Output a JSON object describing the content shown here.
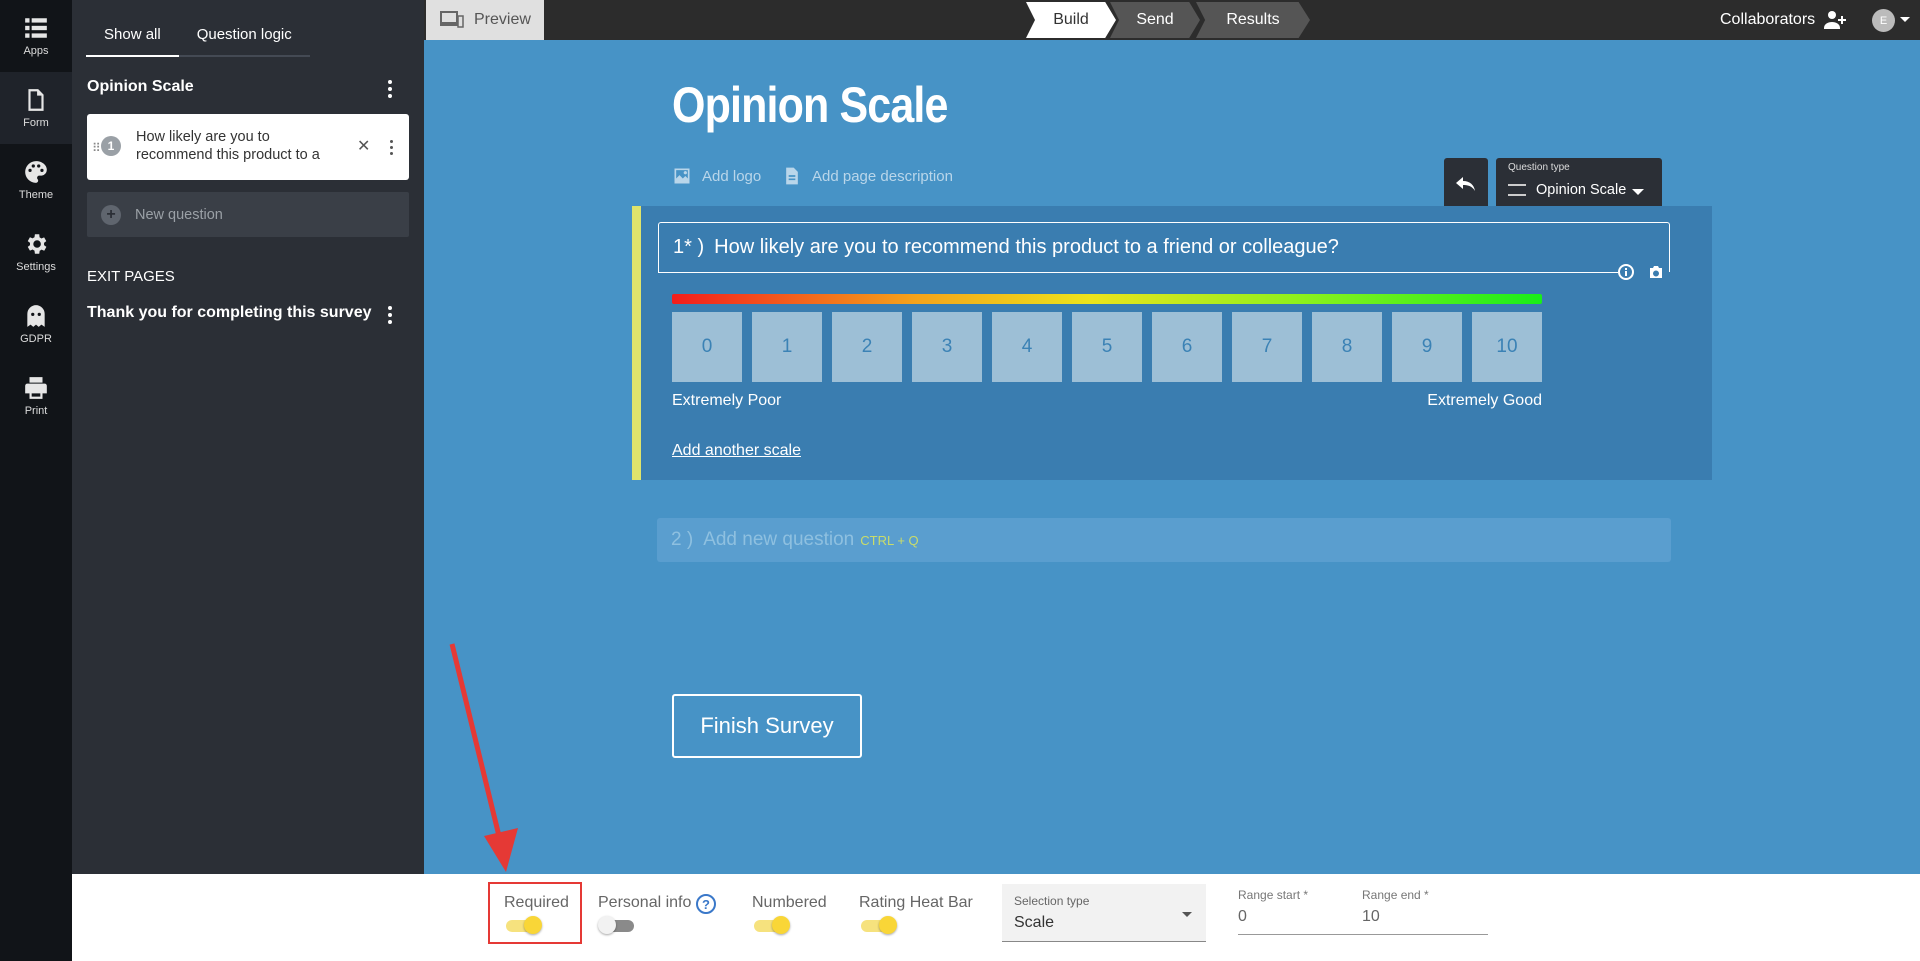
{
  "rail": {
    "items": [
      {
        "label": "Apps",
        "icon": "apps-icon"
      },
      {
        "label": "Form",
        "icon": "form-icon"
      },
      {
        "label": "Theme",
        "icon": "palette-icon"
      },
      {
        "label": "Settings",
        "icon": "gear-icon"
      },
      {
        "label": "GDPR",
        "icon": "ghost-icon"
      },
      {
        "label": "Print",
        "icon": "printer-icon"
      }
    ]
  },
  "sidebar": {
    "tabs": [
      "Show all",
      "Question logic"
    ],
    "section_title": "Opinion Scale",
    "questions": [
      {
        "number": "1",
        "text": "How likely are you to recommend this product to a friend or colleague?"
      }
    ],
    "new_question_label": "New question",
    "exit_pages_label": "EXIT PAGES",
    "exit_page_title": "Thank you for completing this survey"
  },
  "topbar": {
    "preview_label": "Preview",
    "steps": [
      "Build",
      "Send",
      "Results"
    ],
    "collaborators_label": "Collaborators",
    "avatar_initial": "E"
  },
  "form": {
    "title": "Opinion Scale",
    "add_logo": "Add logo",
    "add_description": "Add page description",
    "question_type_label": "Question type",
    "question_type_value": "Opinion Scale",
    "question": {
      "number": "1* )",
      "text": "How likely are you to recommend this product to a friend or colleague?",
      "scale": [
        "0",
        "1",
        "2",
        "3",
        "4",
        "5",
        "6",
        "7",
        "8",
        "9",
        "10"
      ],
      "low_label": "Extremely Poor",
      "high_label": "Extremely Good",
      "add_scale": "Add another scale"
    },
    "new_question": {
      "number": "2 )",
      "placeholder": "Add new question",
      "shortcut": "CTRL + Q"
    },
    "finish_button": "Finish Survey"
  },
  "toolbar": {
    "required_label": "Required",
    "required_on": true,
    "personal_info_label": "Personal info",
    "personal_info_on": false,
    "numbered_label": "Numbered",
    "numbered_on": true,
    "heat_bar_label": "Rating Heat Bar",
    "heat_bar_on": true,
    "selection_type_label": "Selection type",
    "selection_type_value": "Scale",
    "range_start_label": "Range start *",
    "range_start_value": "0",
    "range_end_label": "Range end *",
    "range_end_value": "10"
  },
  "colors": {
    "canvas": "#4793c6",
    "sidebar": "#2b2f36",
    "accent_yellow": "#f9d637",
    "highlight_red": "#e53935"
  }
}
